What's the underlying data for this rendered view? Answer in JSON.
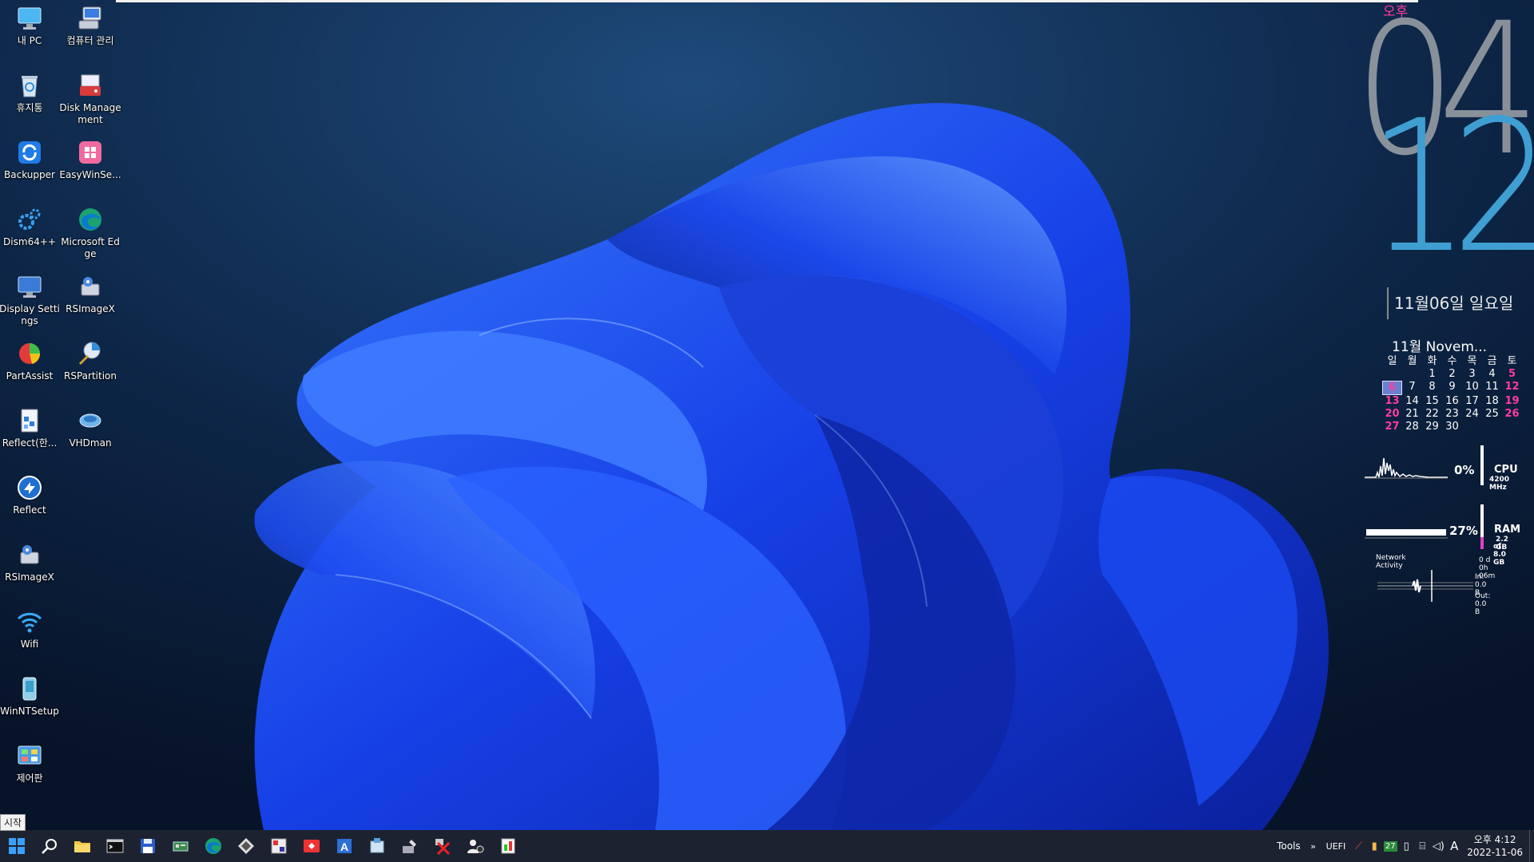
{
  "desktop": {
    "icons": [
      {
        "label": "내 PC",
        "icon": "monitor-icon"
      },
      {
        "label": "컴퓨터 관리",
        "icon": "computer-management-icon"
      },
      {
        "label": "휴지통",
        "icon": "recycle-bin-icon"
      },
      {
        "label": "Disk Management",
        "icon": "disk-management-icon"
      },
      {
        "label": "Backupper",
        "icon": "backupper-icon"
      },
      {
        "label": "EasyWinSe...",
        "icon": "easywinsetup-icon"
      },
      {
        "label": "Dism64++",
        "icon": "gear-icon"
      },
      {
        "label": "Microsoft Edge",
        "icon": "edge-icon"
      },
      {
        "label": "Display Settings",
        "icon": "display-settings-icon"
      },
      {
        "label": "RSImageX",
        "icon": "rsimagex-icon"
      },
      {
        "label": "PartAssist",
        "icon": "partassist-icon"
      },
      {
        "label": "RSPartition",
        "icon": "rspartition-icon"
      },
      {
        "label": "Reflect(한...",
        "icon": "reflect-korean-icon"
      },
      {
        "label": "VHDman",
        "icon": "vhdman-icon"
      },
      {
        "label": "Reflect",
        "icon": "reflect-icon"
      },
      {
        "label": "RSImageX",
        "icon": "rsimagex-icon"
      },
      {
        "label": "Wifi",
        "icon": "wifi-icon"
      },
      {
        "label": "WinNTSetup",
        "icon": "winntsetup-icon"
      },
      {
        "label": "제어판",
        "icon": "control-panel-icon"
      }
    ]
  },
  "clock": {
    "ampm": "오후",
    "hour": "04",
    "minute": "12",
    "date": "11월06일 일요일"
  },
  "calendar": {
    "title": "11월 Novem...",
    "weekdays": [
      "일",
      "월",
      "화",
      "수",
      "목",
      "금",
      "토"
    ],
    "weeks": [
      [
        "",
        "",
        "1",
        "2",
        "3",
        "4",
        "5"
      ],
      [
        "6",
        "7",
        "8",
        "9",
        "10",
        "11",
        "12"
      ],
      [
        "13",
        "14",
        "15",
        "16",
        "17",
        "18",
        "19"
      ],
      [
        "20",
        "21",
        "22",
        "23",
        "24",
        "25",
        "26"
      ],
      [
        "27",
        "28",
        "29",
        "30",
        "",
        "",
        ""
      ]
    ],
    "today": "6"
  },
  "meters": {
    "cpu": {
      "percent": "0%",
      "label": "CPU",
      "sub": "4200 MHz",
      "value": 0
    },
    "ram": {
      "percent": "27%",
      "label": "RAM",
      "sub1": "2.2 GB",
      "sub2": "of 8.0 GB",
      "value": 27
    },
    "network": {
      "title": "Network Activity",
      "uptime": "0 d 0h 06m",
      "in": "In: 0.0 B",
      "out": "Out: 0.0 B"
    }
  },
  "taskbar": {
    "start_tooltip": "시작",
    "apps": [
      "start-icon",
      "search-icon",
      "file-explorer-icon",
      "terminal-icon",
      "floppy-icon",
      "device-icon",
      "edge-icon",
      "tool-icon",
      "image-tool-icon",
      "red-app-icon",
      "text-app-icon",
      "setup-icon",
      "wrench-icon",
      "network-x-icon",
      "users-icon",
      "green-app-icon"
    ],
    "tray": {
      "tools_label": "Tools",
      "uefi_label": "UEFI",
      "badge": "27",
      "ime": "A",
      "time": "오후 4:12",
      "date": "2022-11-06"
    }
  },
  "colors": {
    "accent_pink": "#ff3ba0",
    "minute_blue": "#3f9fd2",
    "taskbar": "#1c2230"
  }
}
